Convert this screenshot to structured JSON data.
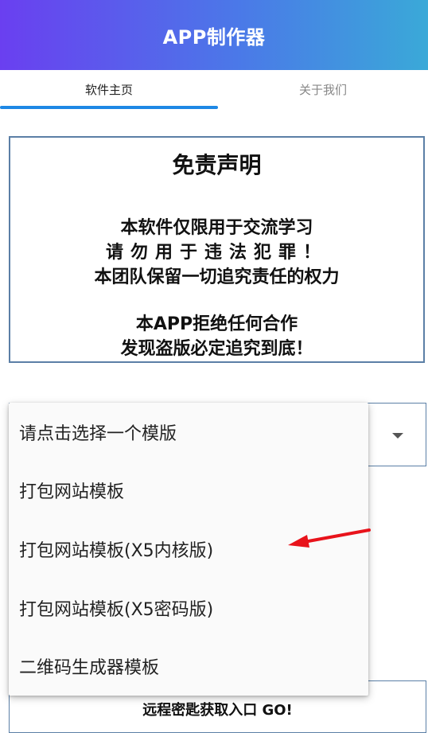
{
  "app": {
    "title": "APP制作器"
  },
  "tabs": [
    {
      "label": "软件主页",
      "selected": true
    },
    {
      "label": "关于我们",
      "selected": false
    }
  ],
  "disclaimer": {
    "title": "免责声明",
    "lines": [
      "本软件仅限用于交流学习",
      "请勿用于违法犯罪！",
      "本团队保留一切追究责任的权力",
      "本APP拒绝任何合作",
      "发现盗版必定追究到底！"
    ]
  },
  "dropdown": {
    "items": [
      "请点击选择一个模版",
      "打包网站模板",
      "打包网站模板(X5内核版)",
      "打包网站模板(X5密码版)",
      "二维码生成器模板"
    ]
  },
  "go_button": {
    "label": "远程密匙获取入口 GO!"
  },
  "colors": {
    "accent": "#1e88e5",
    "annotation_arrow": "#e8131b",
    "border": "#5b7fa6"
  }
}
